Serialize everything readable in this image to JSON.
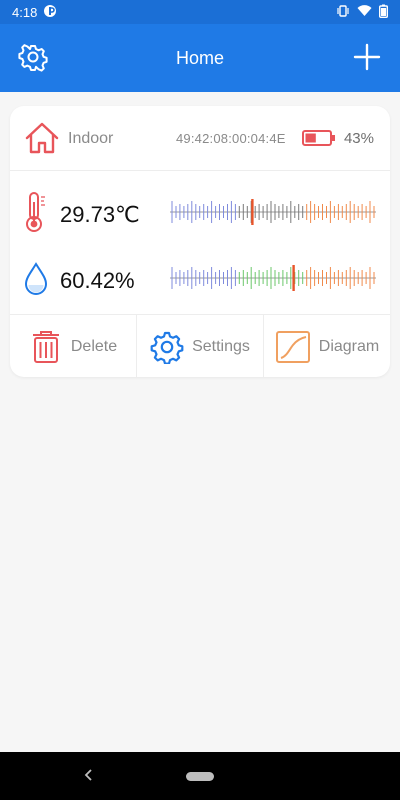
{
  "status_bar": {
    "time": "4:18"
  },
  "app_bar": {
    "title": "Home"
  },
  "device": {
    "name": "Indoor",
    "id": "49:42:08:00:04:4E",
    "battery_percent": "43%",
    "battery_level": 0.43
  },
  "readings": {
    "temperature": {
      "value": "29.73℃",
      "scale_position": 0.4
    },
    "humidity": {
      "value": "60.42%",
      "scale_position": 0.6
    }
  },
  "actions": {
    "delete_label": "Delete",
    "settings_label": "Settings",
    "diagram_label": "Diagram"
  },
  "colors": {
    "app_bar": "#1f7ae6",
    "status_bar": "#1b6fd6",
    "delete_red": "#e8555a",
    "settings_blue": "#1f7ae6",
    "diagram_orange": "#f0a060",
    "scale_blue": "#7f8bdc",
    "scale_green": "#6cc76b",
    "scale_orange": "#f08a4b"
  },
  "icons": {
    "settings": "gear-icon",
    "add": "plus-icon",
    "home": "house-icon",
    "battery": "battery-icon",
    "temperature": "thermometer-icon",
    "humidity": "water-drop-icon",
    "delete": "trash-icon",
    "diagram": "chart-icon"
  }
}
